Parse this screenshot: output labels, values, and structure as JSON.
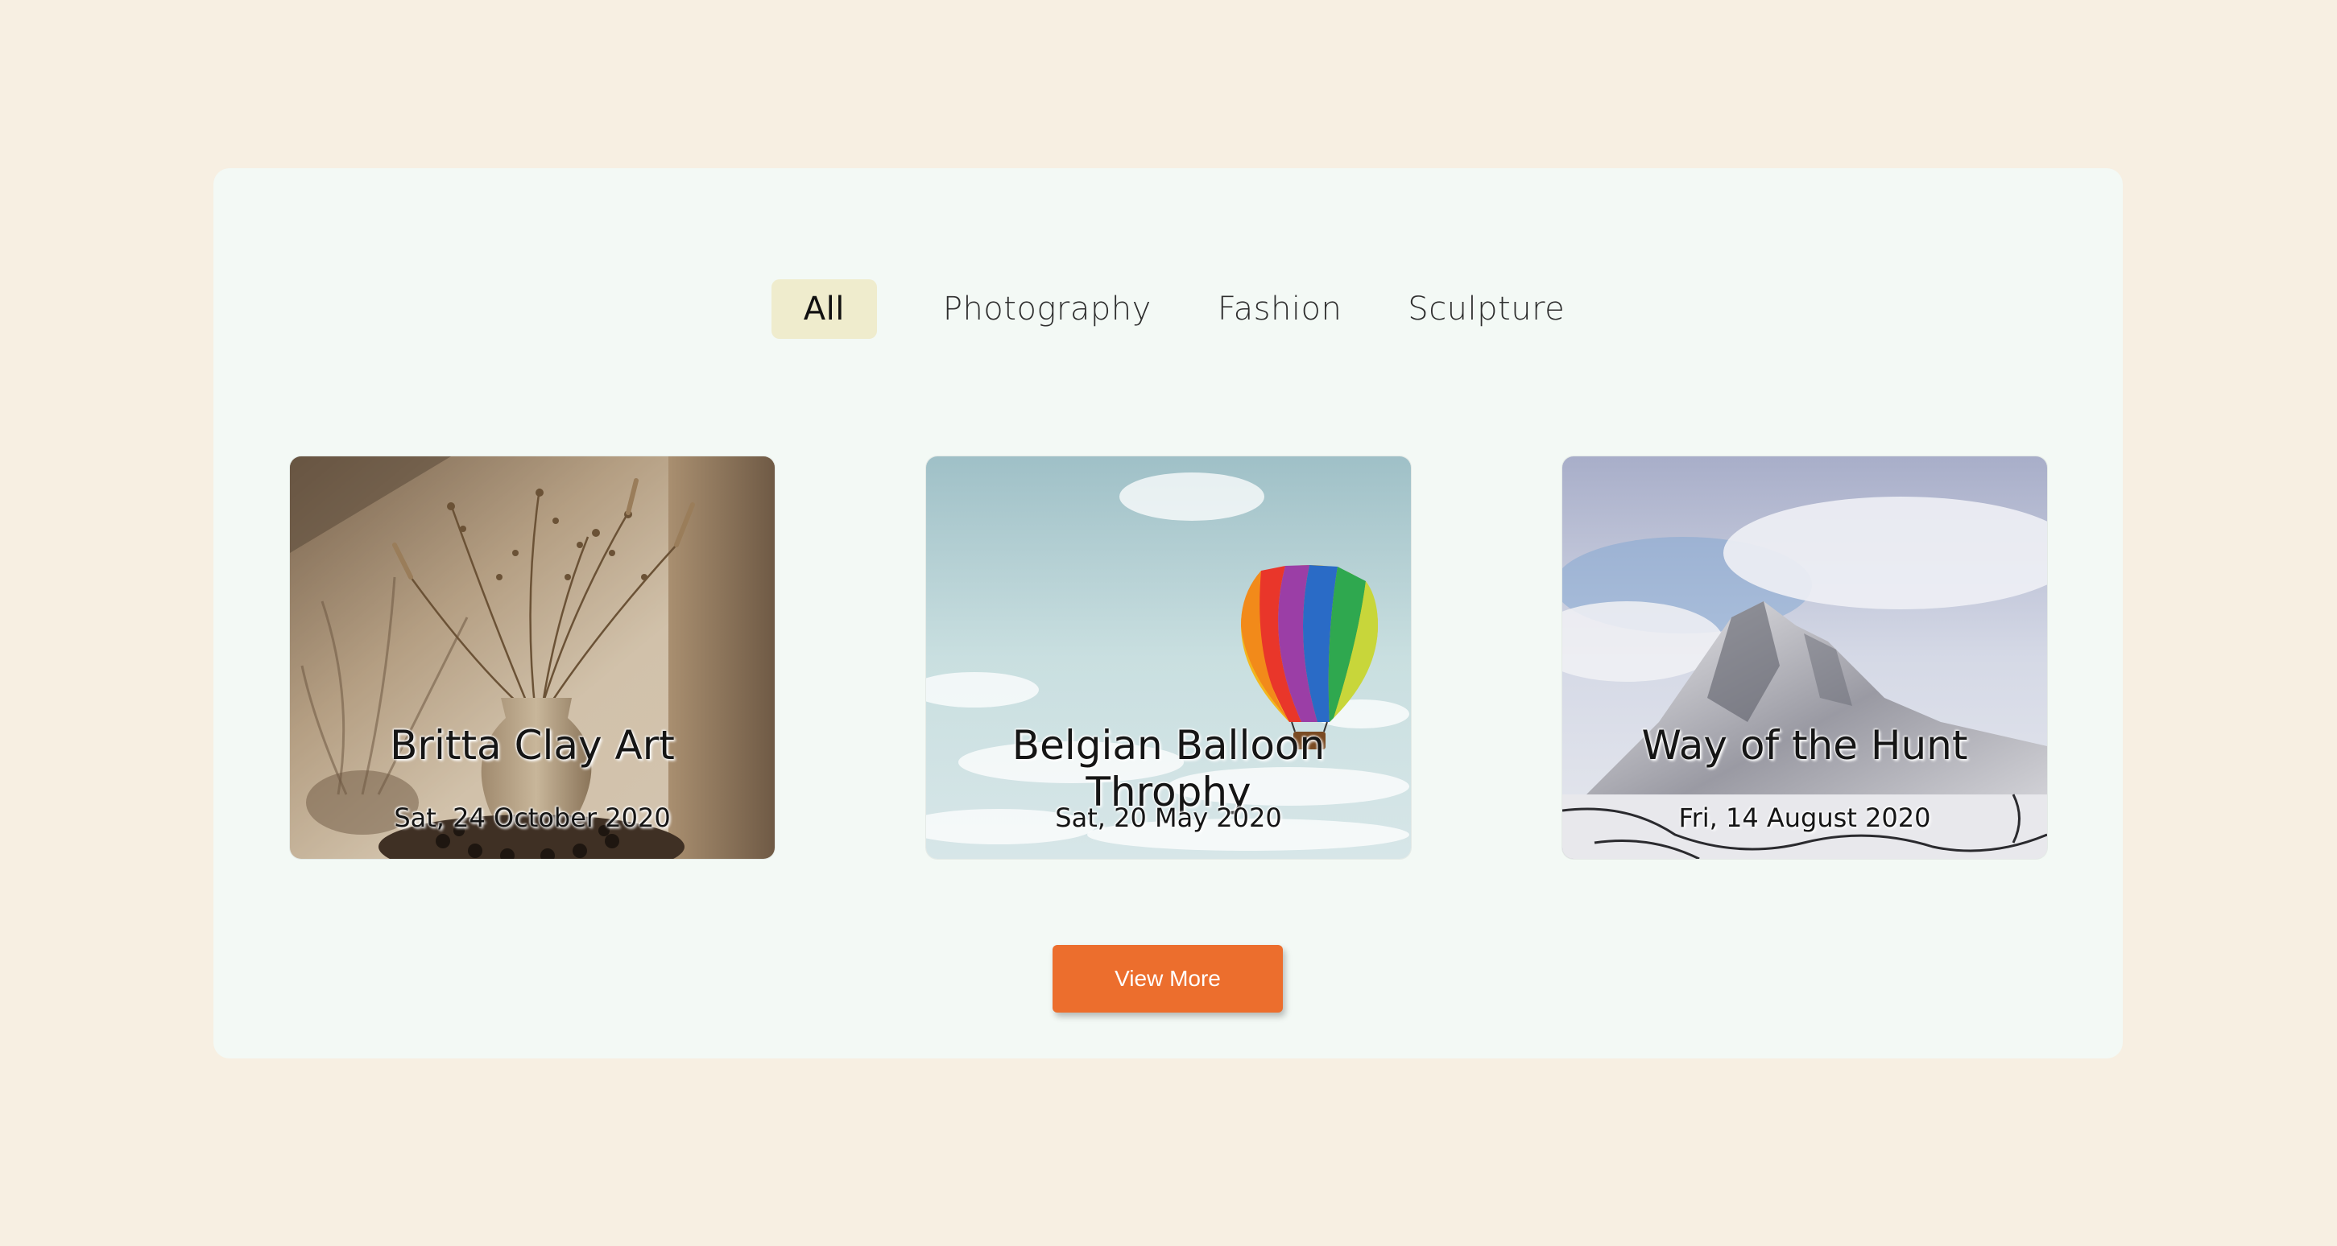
{
  "filters": {
    "tabs": [
      {
        "label": "All",
        "active": true
      },
      {
        "label": "Photography",
        "active": false
      },
      {
        "label": "Fashion",
        "active": false
      },
      {
        "label": "Sculpture",
        "active": false
      }
    ]
  },
  "cards": [
    {
      "title": "Britta Clay Art",
      "date": "Sat, 24 October 2020",
      "image": "vase-with-dried-flowers"
    },
    {
      "title": "Belgian Balloon Throphy",
      "date": "Sat, 20 May 2020",
      "image": "hot-air-balloon-sky"
    },
    {
      "title": "Way of the Hunt",
      "date": "Fri, 14 August 2020",
      "image": "snowy-mountain"
    }
  ],
  "actions": {
    "view_more_label": "View More"
  },
  "colors": {
    "page_background": "#f7efe2",
    "panel_background": "#f3f9f5",
    "active_tab": "#efeccd",
    "button": "#ec6e2d"
  }
}
